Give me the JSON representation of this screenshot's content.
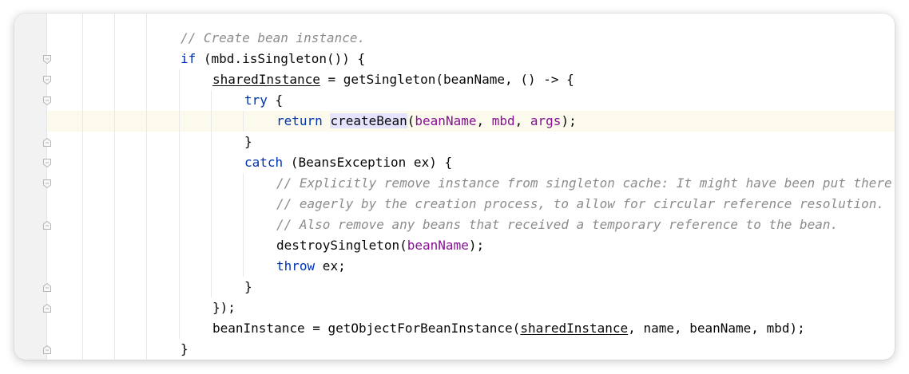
{
  "editor": {
    "lines": {
      "l1": {
        "comment": "// Create bean instance."
      },
      "l2": {
        "kw": "if",
        "rest": " (mbd.isSingleton()) {"
      },
      "l3": {
        "var": "sharedInstance",
        "rest": " = getSingleton(beanName, () -> {"
      },
      "l4": {
        "kw": "try",
        "rest": " {"
      },
      "l5": {
        "kw": "return",
        "space": " ",
        "method": "createBean",
        "open": "(",
        "p1": "beanName",
        "sep1": ", ",
        "p2": "mbd",
        "sep2": ", ",
        "p3": "args",
        "close": ");"
      },
      "l6": {
        "text": "}"
      },
      "l7": {
        "kw": "catch",
        "rest": " (BeansException ex) {"
      },
      "l8": {
        "comment": "// Explicitly remove instance from singleton cache: It might have been put there"
      },
      "l9": {
        "comment": "// eagerly by the creation process, to allow for circular reference resolution."
      },
      "l10": {
        "comment": "// Also remove any beans that received a temporary reference to the bean."
      },
      "l11": {
        "pre": "destroySingleton(",
        "param": "beanName",
        "post": ");"
      },
      "l12": {
        "kw": "throw",
        "rest": " ex;"
      },
      "l13": {
        "text": "}"
      },
      "l14": {
        "text": "});"
      },
      "l15": {
        "pre": "beanInstance = getObjectForBeanInstance(",
        "var": "sharedInstance",
        "post": ", name, beanName, mbd);"
      },
      "l16": {
        "text": "}"
      }
    }
  },
  "colors": {
    "keyword": "#0033b3",
    "comment": "#8c8c8c",
    "parameter": "#871094",
    "current_line": "#fcfaed",
    "usage_highlight": "#e4e4ff",
    "gutter": "#f2f2f2"
  },
  "icons": [
    "fold-start-icon",
    "fold-end-icon"
  ]
}
